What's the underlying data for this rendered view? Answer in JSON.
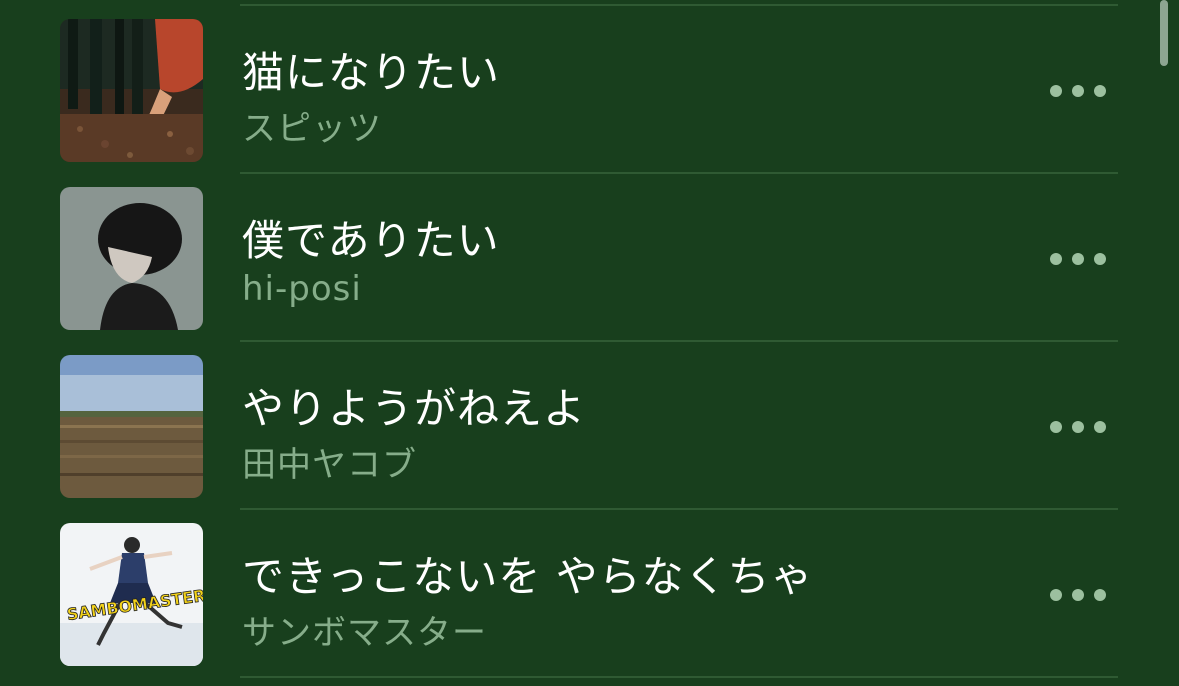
{
  "songs": [
    {
      "title": "猫になりたい",
      "artist": "スピッツ",
      "art": "bamboo-cover",
      "more": "more-icon"
    },
    {
      "title": "僕でありたい",
      "artist": "hi-posi",
      "art": "portrait-cover",
      "more": "more-icon"
    },
    {
      "title": "やりようがねえよ",
      "artist": "田中ヤコブ",
      "art": "field-cover",
      "more": "more-icon"
    },
    {
      "title": "できっこないを やらなくちゃ",
      "artist": "サンボマスター",
      "art": "sambomaster-cover",
      "art_logo": "SAMBOMASTER",
      "more": "more-icon"
    }
  ],
  "colors": {
    "background": "#183f1d",
    "title": "#ffffff",
    "artist": "#86ad8a",
    "separator": "#2f5a33",
    "more_dots": "#9cc09f"
  }
}
